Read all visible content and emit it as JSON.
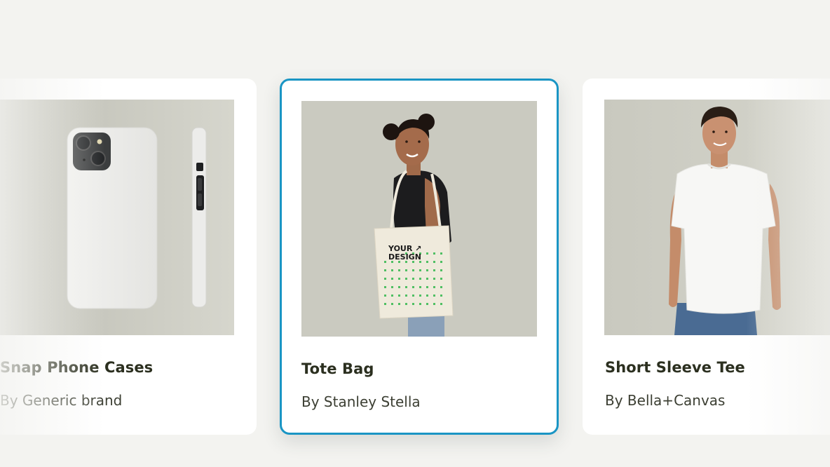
{
  "carousel": {
    "cards": [
      {
        "title": "Snap Phone Cases",
        "brand": "By Generic brand",
        "image": "phone-case-mockup",
        "selected": false
      },
      {
        "title": "Tote Bag",
        "brand": "By Stanley Stella",
        "image": "tote-bag-model",
        "print_text": "YOUR DESIGN",
        "selected": true
      },
      {
        "title": "Short Sleeve Tee",
        "brand": "By Bella+Canvas",
        "image": "t-shirt-model",
        "selected": false
      }
    ]
  },
  "colors": {
    "background": "#f3f3f0",
    "selected_border": "#1a95c4",
    "title_text": "#2b2f1f",
    "image_background": "#cfcfc5"
  }
}
